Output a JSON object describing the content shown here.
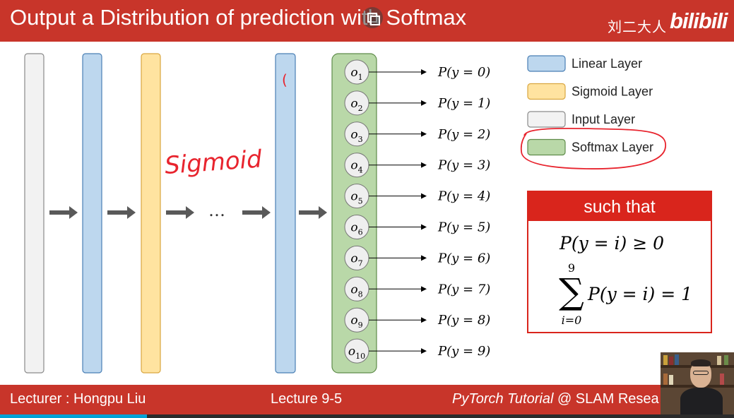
{
  "header": {
    "title": "Output a Distribution of prediction with Softmax",
    "watermark_cn": "刘二大人",
    "watermark_brand": "bilibili"
  },
  "diagram": {
    "ellipsis": "…",
    "annotations": {
      "sigmoid_handwritten": "Sigmoid",
      "paren_handwritten": "("
    },
    "outputs": [
      {
        "node": "o",
        "sub": "1",
        "label": "P(y = 0)"
      },
      {
        "node": "o",
        "sub": "2",
        "label": "P(y = 1)"
      },
      {
        "node": "o",
        "sub": "3",
        "label": "P(y = 2)"
      },
      {
        "node": "o",
        "sub": "4",
        "label": "P(y = 3)"
      },
      {
        "node": "o",
        "sub": "5",
        "label": "P(y = 4)"
      },
      {
        "node": "o",
        "sub": "6",
        "label": "P(y = 5)"
      },
      {
        "node": "o",
        "sub": "7",
        "label": "P(y = 6)"
      },
      {
        "node": "o",
        "sub": "8",
        "label": "P(y = 7)"
      },
      {
        "node": "o",
        "sub": "9",
        "label": "P(y = 8)"
      },
      {
        "node": "o",
        "sub": "10",
        "label": "P(y = 9)"
      }
    ]
  },
  "legend": {
    "items": [
      {
        "label": "Linear Layer",
        "color": "#bdd7ee",
        "stroke": "#4a7fb5"
      },
      {
        "label": "Sigmoid Layer",
        "color": "#ffe3a0",
        "stroke": "#d9a640"
      },
      {
        "label": "Input Layer",
        "color": "#f2f2f2",
        "stroke": "#8a8a8a"
      },
      {
        "label": "Softmax Layer",
        "color": "#b9d8a8",
        "stroke": "#5f8c4a"
      }
    ]
  },
  "constraint_box": {
    "header": "such that",
    "cond1": "P(y = i) ≥ 0",
    "sum_top": "9",
    "sum_bottom": "i=0",
    "sum_symbol": "∑",
    "cond2": "P(y = i) = 1"
  },
  "footer": {
    "lecturer": "Lecturer : Hongpu Liu",
    "lecture": "Lecture 9-5",
    "tutorial_italic": "PyTorch Tutorial",
    "tutorial_rest": " @ SLAM Resea",
    "progress_fraction": 0.2
  },
  "colors": {
    "header_red": "#c8352a",
    "annotation_red": "#e8242e",
    "arrow_gray": "#595959",
    "box_red": "#d9251c"
  }
}
